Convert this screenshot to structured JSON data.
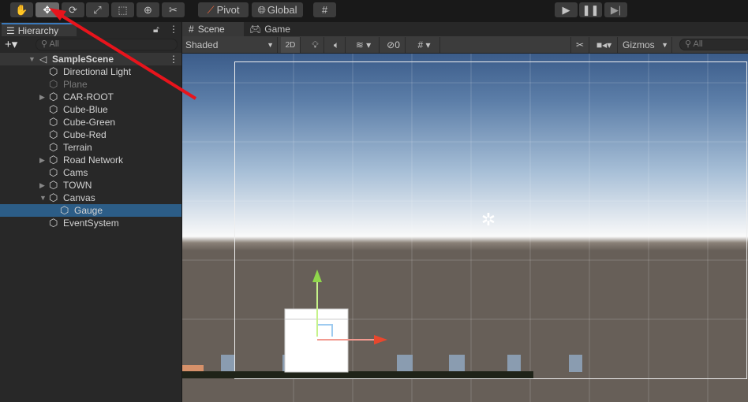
{
  "toolbar": {
    "tools": [
      "hand-tool",
      "move-tool",
      "rotate-tool",
      "scale-tool",
      "rect-tool",
      "transform-tool",
      "custom-tool"
    ],
    "pivot": "Pivot",
    "global": "Global"
  },
  "hierarchy": {
    "title": "Hierarchy",
    "search_placeholder": "All",
    "scene": "SampleScene",
    "items": [
      {
        "label": "Directional Light"
      },
      {
        "label": "Plane"
      },
      {
        "label": "CAR-ROOT"
      },
      {
        "label": "Cube-Blue"
      },
      {
        "label": "Cube-Green"
      },
      {
        "label": "Cube-Red"
      },
      {
        "label": "Terrain"
      },
      {
        "label": "Road Network"
      },
      {
        "label": "Cams"
      },
      {
        "label": "TOWN"
      },
      {
        "label": "Canvas"
      },
      {
        "label": "Gauge"
      },
      {
        "label": "EventSystem"
      }
    ]
  },
  "scene": {
    "tabs": [
      "Scene",
      "Game"
    ],
    "shading": "Shaded",
    "mode2d": "2D",
    "hidden_count": "0",
    "gizmos": "Gizmos",
    "search_placeholder": "All"
  },
  "colors": {
    "selection": "#2c5d87",
    "annotation_arrow": "#e8141c",
    "x_axis": "#e8472d",
    "y_axis": "#8fd64b"
  }
}
